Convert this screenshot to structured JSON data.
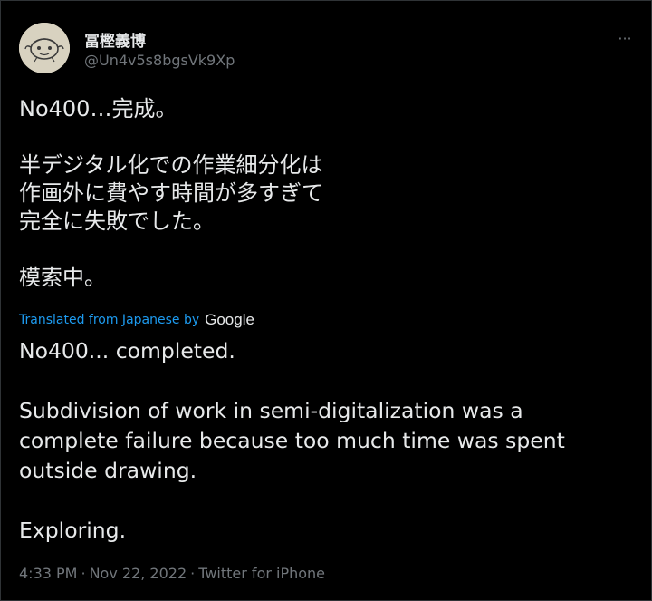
{
  "author": {
    "display_name": "冨樫義博",
    "handle": "@Un4v5s8bgsVk9Xp"
  },
  "more_button_label": "···",
  "tweet": {
    "original_text": "No400…完成。\n\n半デジタル化での作業細分化は\n作画外に費やす時間が多すぎて\n完全に失敗でした。\n\n模索中。",
    "translation_label": "Translated from Japanese by",
    "translation_provider": "Google",
    "translated_text": "No400... completed.\n\nSubdivision of work in semi-digitalization was a\ncomplete failure because too much time was spent\noutside drawing.\n\nExploring."
  },
  "meta": {
    "time": "4:33 PM",
    "separator": "·",
    "date": "Nov 22, 2022",
    "source": "Twitter for iPhone"
  },
  "colors": {
    "background": "#000000",
    "text": "#e7e9ea",
    "secondary": "#71767b",
    "link": "#1d9bf0"
  },
  "icons": {
    "avatar": "sketch-face-avatar",
    "more": "more-horizontal-icon"
  }
}
